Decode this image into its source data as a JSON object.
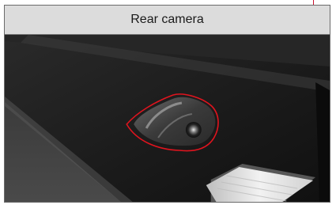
{
  "header": {
    "title": "Rear camera"
  },
  "photo": {
    "subject": "rear-camera-photo",
    "highlight_color": "#e0141e"
  }
}
